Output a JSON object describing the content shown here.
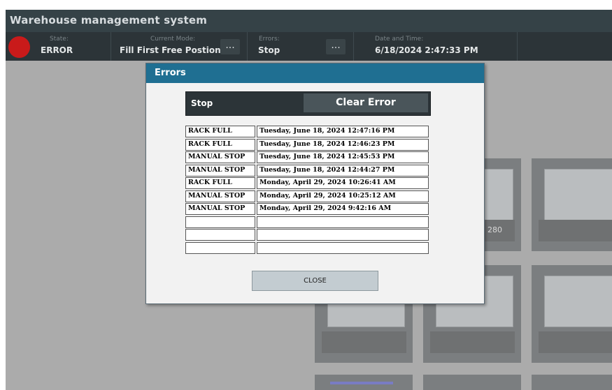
{
  "app": {
    "title": "Warehouse management system"
  },
  "status": {
    "state_label": "State:",
    "state_value": "ERROR",
    "mode_label": "Current Mode:",
    "mode_value": "Fill First Free Postion",
    "errors_label": "Errors:",
    "errors_value": "Stop",
    "datetime_label": "Date and Time:",
    "datetime_value": "6/18/2024 2:47:33 PM",
    "dots": "...",
    "state_color": "#c91a1a"
  },
  "background": {
    "tile_label": "280"
  },
  "dialog": {
    "title": "Errors",
    "stop_text": "Stop",
    "clear_button": "Clear Error",
    "close_button": "CLOSE",
    "rows": [
      {
        "type": "RACK FULL",
        "time": "Tuesday, June 18, 2024 12:47:16 PM"
      },
      {
        "type": "RACK FULL",
        "time": "Tuesday, June 18, 2024 12:46:23 PM"
      },
      {
        "type": "MANUAL STOP",
        "time": "Tuesday, June 18, 2024 12:45:53 PM"
      },
      {
        "type": "MANUAL STOP",
        "time": "Tuesday, June 18, 2024 12:44:27 PM"
      },
      {
        "type": "RACK FULL",
        "time": "Monday, April 29, 2024 10:26:41 AM"
      },
      {
        "type": "MANUAL STOP",
        "time": "Monday, April 29, 2024 10:25:12 AM"
      },
      {
        "type": "MANUAL STOP",
        "time": "Monday, April 29, 2024 9:42:16 AM"
      },
      {
        "type": "",
        "time": ""
      },
      {
        "type": "",
        "time": ""
      },
      {
        "type": "",
        "time": ""
      }
    ]
  }
}
